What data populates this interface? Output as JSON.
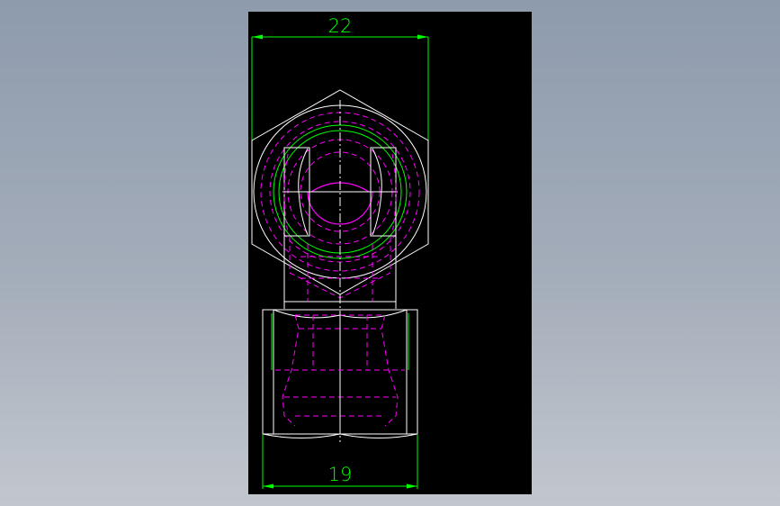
{
  "drawing": {
    "dimension_top": "22",
    "dimension_bottom": "19"
  },
  "colors": {
    "background_gradient_top": "#8e9bad",
    "background_gradient_bottom": "#c2c7ce",
    "canvas": "#000000",
    "outline": "#ffffff",
    "dimension": "#00ff00",
    "hidden_line": "#ff00ff",
    "center_line": "#ffffff",
    "thread_circle": "#00ff00"
  }
}
